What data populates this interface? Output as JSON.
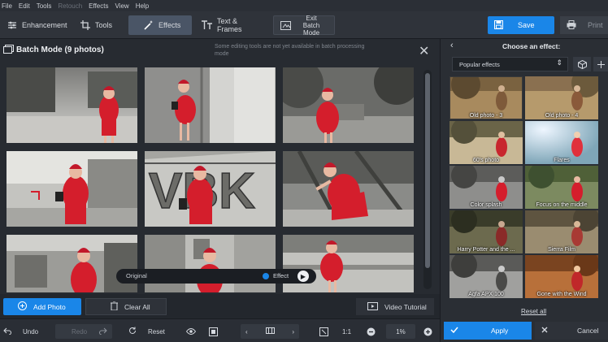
{
  "menu": {
    "items": [
      "File",
      "Edit",
      "Tools",
      "Retouch",
      "Effects",
      "View",
      "Help"
    ],
    "disabled": [
      "Retouch"
    ]
  },
  "toolbar": {
    "tabs": [
      {
        "label": "Enhancement",
        "icon": "sliders-icon"
      },
      {
        "label": "Tools",
        "icon": "crop-icon"
      },
      {
        "label": "Effects",
        "icon": "magic-wand-icon",
        "active": true
      },
      {
        "label": "Text & Frames",
        "icon": "text-icon"
      }
    ],
    "exit_label_line1": "Exit",
    "exit_label_line2": "Batch Mode",
    "save_label": "Save",
    "print_label": "Print"
  },
  "batch": {
    "title": "Batch Mode (9 photos)",
    "note": "Some editing tools are not yet available in batch processing mode",
    "compare_original": "Original",
    "compare_effect": "Effect",
    "photo_count": 9
  },
  "actions": {
    "add_photo": "Add Photo",
    "clear_all": "Clear All",
    "video_tutorial": "Video Tutorial"
  },
  "bottombar": {
    "undo": "Undo",
    "redo": "Redo",
    "reset": "Reset",
    "zoom_ratio": "1:1",
    "zoom_percent": "1%"
  },
  "effects_panel": {
    "title": "Choose an effect:",
    "category": "Popular effects",
    "effects": [
      "Old photo - 3",
      "Old photo - 4",
      "60's photo",
      "Flares",
      "Color splash",
      "Focus on the middle",
      "Harry Potter and the ...",
      "Sierra Film",
      "Agfa APX 100",
      "Gone with the Wind"
    ],
    "reset_all": "Reset all",
    "apply": "Apply",
    "cancel": "Cancel"
  },
  "colors": {
    "accent": "#1a86e8",
    "subject_red": "#d41e2c",
    "panel_bg": "#2a2e34"
  }
}
